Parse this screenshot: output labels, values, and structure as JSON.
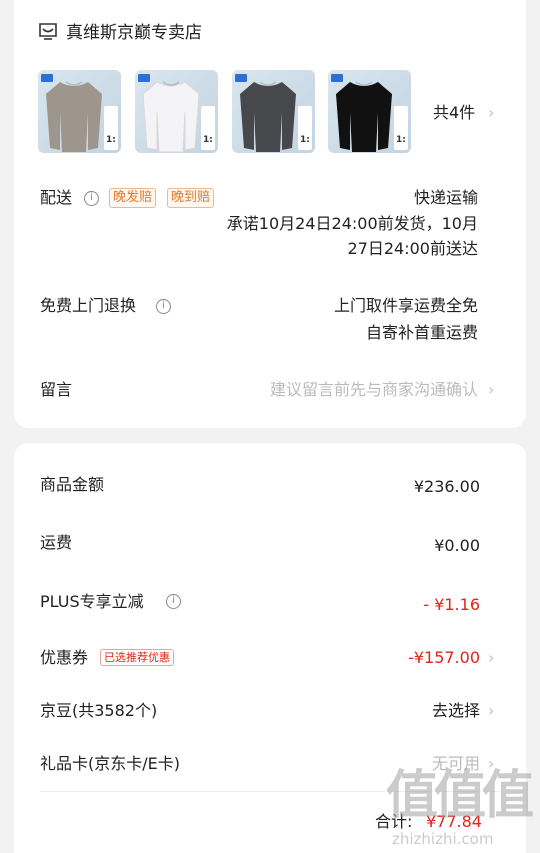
{
  "store": {
    "name": "真维斯京巅专卖店",
    "icon": "shop-icon"
  },
  "products": {
    "items": [
      {
        "color": "#9e968c",
        "badge_text": "1:"
      },
      {
        "color": "#f4f4f6",
        "badge_text": "1:"
      },
      {
        "color": "#46484c",
        "badge_text": "1:"
      },
      {
        "color": "#111111",
        "badge_text": "1:"
      }
    ],
    "count_label": "共4件"
  },
  "delivery": {
    "label": "配送",
    "tags": [
      "晚发赔",
      "晚到赔"
    ],
    "method": "快递运输",
    "promise_line1": "承诺10月24日24:00前发货，10月",
    "promise_line2": "27日24:00前送达"
  },
  "returns": {
    "label": "免费上门退换",
    "line1": "上门取件享运费全免",
    "line2": "自寄补首重运费"
  },
  "message": {
    "label": "留言",
    "placeholder": "建议留言前先与商家沟通确认"
  },
  "summary": {
    "goods_amount": {
      "label": "商品金额",
      "value": "¥236.00"
    },
    "shipping": {
      "label": "运费",
      "value": "¥0.00"
    },
    "plus": {
      "label": "PLUS专享立减",
      "value": "- ¥1.16"
    },
    "coupon": {
      "label": "优惠券",
      "tag": "已选推荐优惠",
      "value": "-¥157.00"
    },
    "jingdou": {
      "label": "京豆(共3582个)",
      "value": "去选择"
    },
    "giftcard": {
      "label": "礼品卡(京东卡/E卡)",
      "value": "无可用"
    },
    "total": {
      "label": "合计:",
      "value": "¥77.84"
    }
  },
  "watermark": {
    "logo": "值",
    "domain": "zhizhizhi.com"
  },
  "colors": {
    "accent": "#e2231a",
    "tag_orange": "#e77a2a"
  }
}
